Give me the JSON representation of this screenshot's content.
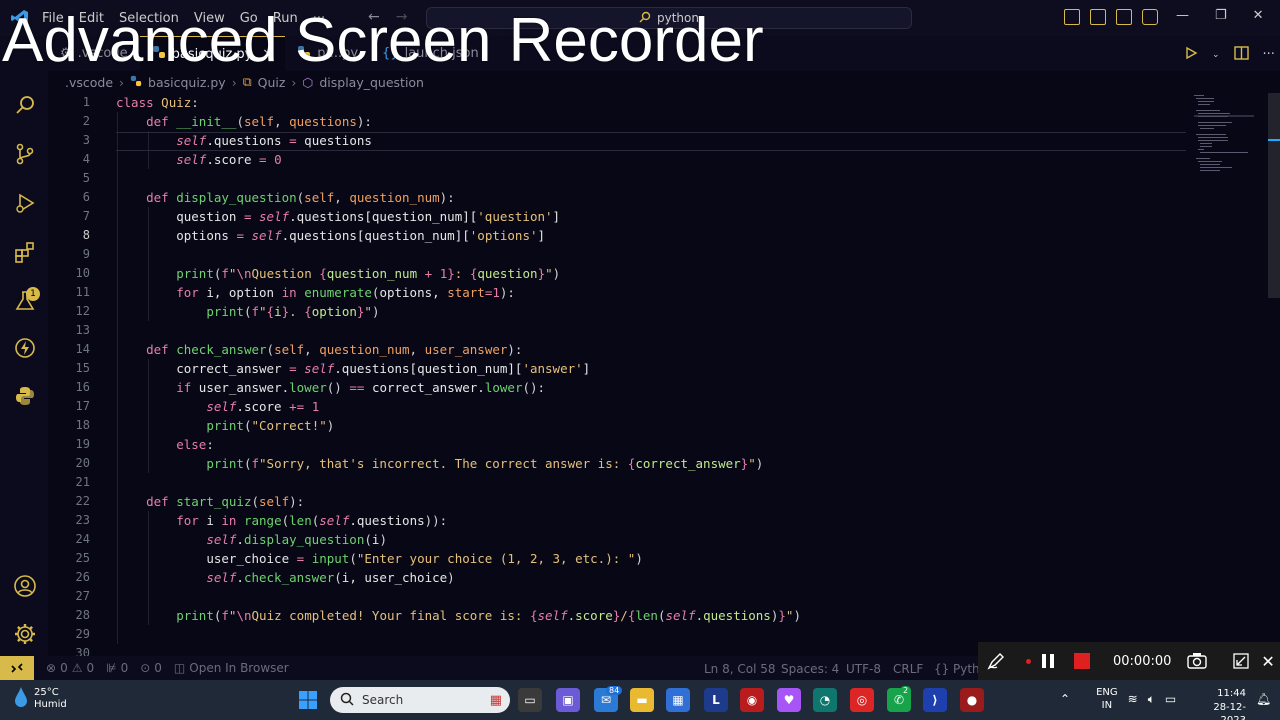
{
  "watermark": "Advanced Screen Recorder",
  "menu": [
    "File",
    "Edit",
    "Selection",
    "View",
    "Go",
    "Run",
    "···"
  ],
  "command_center": "python",
  "tabs": [
    {
      "label": ".vscode",
      "active": false
    },
    {
      "label": "basicquiz.py",
      "active": true
    },
    {
      "label": "pr...py",
      "active": false
    },
    {
      "label": "launch.json",
      "active": false
    }
  ],
  "breadcrumbs": [
    ".vscode",
    "basicquiz.py",
    "Quiz",
    "display_question"
  ],
  "editor": {
    "current_line": 8,
    "line_numbers": [
      "1",
      "2",
      "3",
      "4",
      "5",
      "6",
      "7",
      "8",
      "9",
      "10",
      "11",
      "12",
      "13",
      "14",
      "15",
      "16",
      "17",
      "18",
      "19",
      "20",
      "21",
      "22",
      "23",
      "24",
      "25",
      "26",
      "27",
      "28",
      "29",
      "30"
    ]
  },
  "status": {
    "errors": "0",
    "warnings": "0",
    "ports": "0",
    "live": "0",
    "open_in_browser": "Open In Browser",
    "position": "Ln 8, Col 58",
    "spaces": "Spaces: 4",
    "encoding": "UTF-8",
    "eol": "CRLF",
    "language": "Pyth"
  },
  "recorder": {
    "timer": "00:00:00"
  },
  "taskbar": {
    "temperature": "25°C",
    "weather": "Humid",
    "search_placeholder": "Search",
    "lang_top": "ENG",
    "lang_bottom": "IN",
    "time": "11:44",
    "date": "28-12-2023",
    "store_badge": "84",
    "whatsapp_badge": "2"
  },
  "colors": {
    "accent": "#d7ba4a",
    "editor_bg": "#070716",
    "taskbar": "#1f2937"
  }
}
